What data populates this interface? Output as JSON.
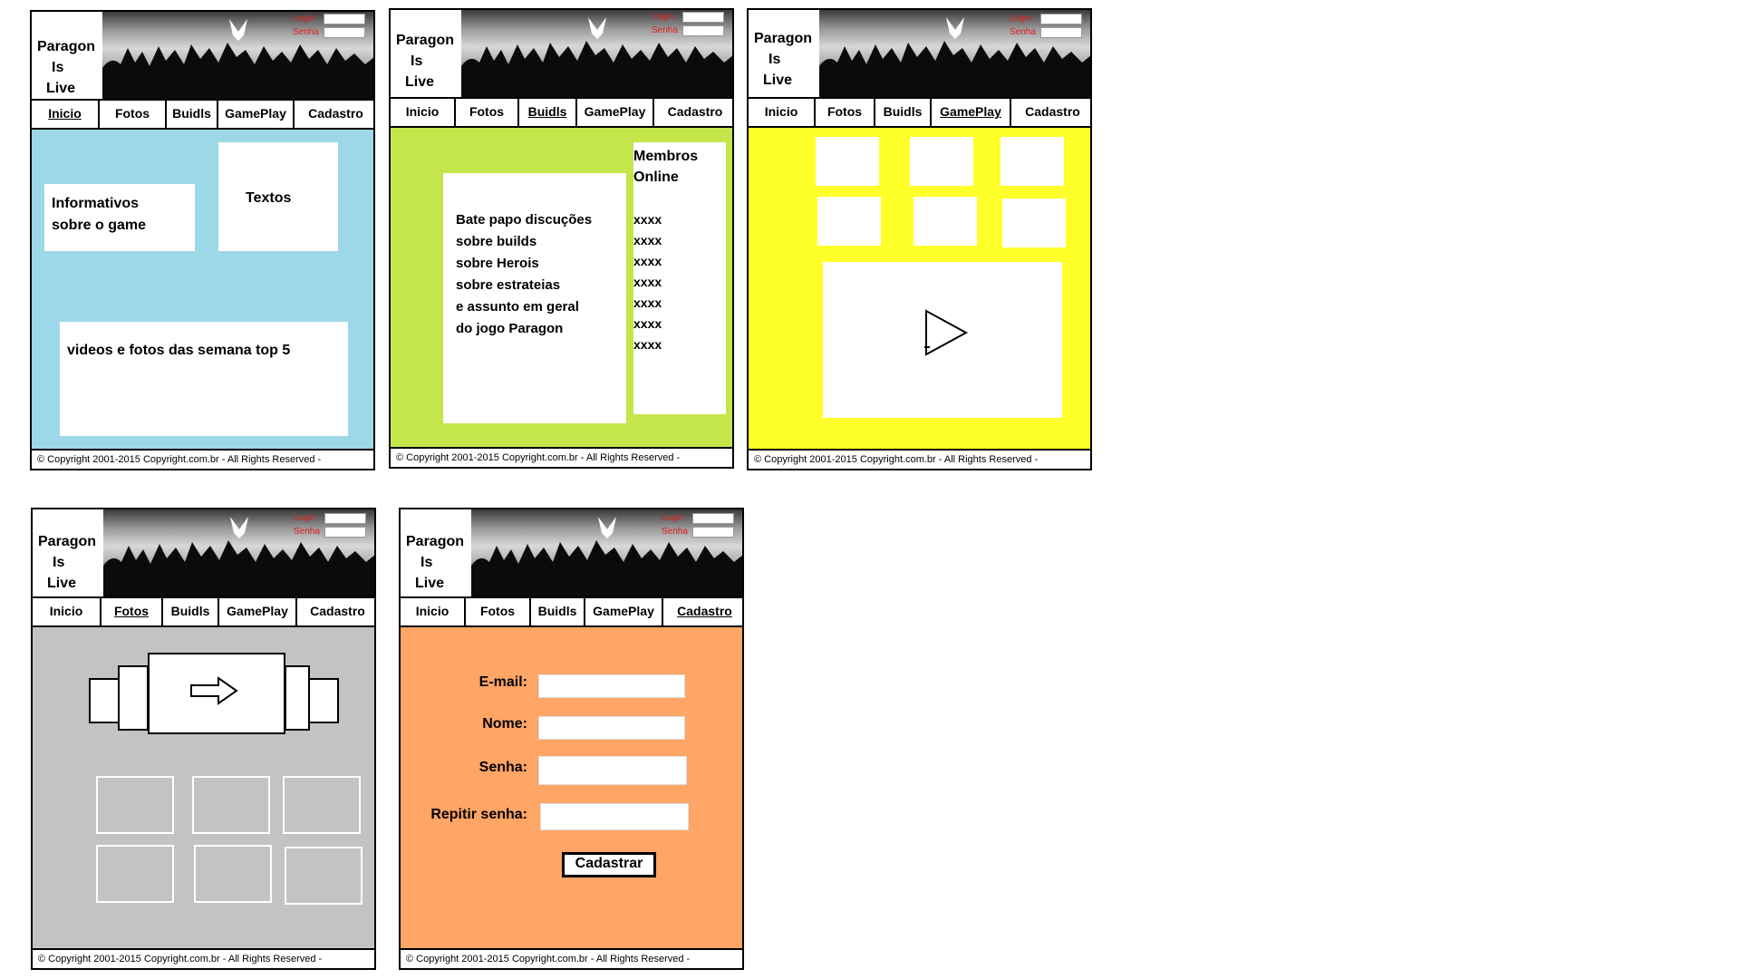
{
  "site": {
    "logo": [
      "Paragon",
      "Is",
      "Live"
    ],
    "login_label": "Login",
    "senha_label": "Senha",
    "nav": [
      "Inicio",
      "Fotos",
      "Buidls",
      "GamePlay",
      "Cadastro"
    ],
    "copyright": "© Copyright 2001-2015 Copyright.com.br - All Rights Reserved -"
  },
  "colors": {
    "inicio_bg": "#9dd8e8",
    "buidls_bg": "#c4e64a",
    "gameplay_bg": "#ffff2a",
    "fotos_bg": "#c3c3c3",
    "cadastro_bg": "#ffa566",
    "login_red": "#e02020"
  },
  "pages": {
    "inicio": {
      "info_text": [
        "Informativos",
        "sobre o game"
      ],
      "textos": "Textos",
      "videos": "videos e fotos das semana top 5"
    },
    "buidls": {
      "chat_lines": [
        "Bate papo discuções",
        "sobre builds",
        "sobre Herois",
        "sobre estrateias",
        "e assunto em geral",
        "do jogo Paragon"
      ],
      "members_title": [
        "Membros",
        "Online"
      ],
      "members": [
        "xxxx",
        "xxxx",
        "xxxx",
        "xxxx",
        "xxxx",
        "xxxx",
        "xxxx"
      ]
    },
    "gameplay": {
      "icon": "play-icon"
    },
    "fotos": {
      "icon": "arrow-right-icon"
    },
    "cadastro": {
      "email_label": "E-mail:",
      "nome_label": "Nome:",
      "senha_label": "Senha:",
      "repetir_label": "Repitir senha:",
      "button": "Cadastrar"
    }
  }
}
